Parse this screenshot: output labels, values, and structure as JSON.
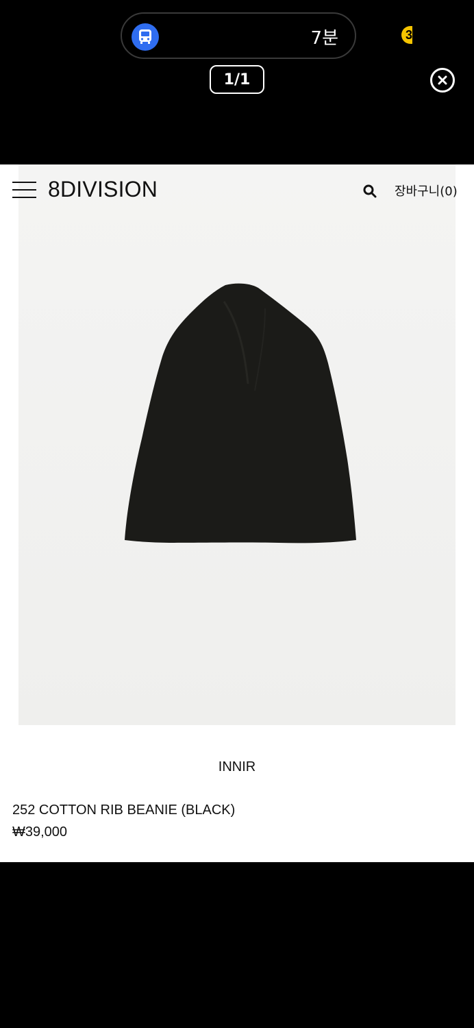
{
  "overlay": {
    "transit_time": "7분",
    "page_counter": "1/1",
    "badge_text": "3"
  },
  "shop": {
    "logo": "8DIVISION",
    "cart_label": "장바구니(0)",
    "product": {
      "brand": "INNIR",
      "name": "252 COTTON RIB BEANIE (BLACK)",
      "price": "₩39,000"
    }
  },
  "colors": {
    "bus_icon_bg": "#2f6df0",
    "badge": "#f5c400",
    "beanie": "#1a1a17"
  },
  "icons": [
    "bus-icon",
    "close-icon",
    "menu-icon",
    "search-icon"
  ]
}
